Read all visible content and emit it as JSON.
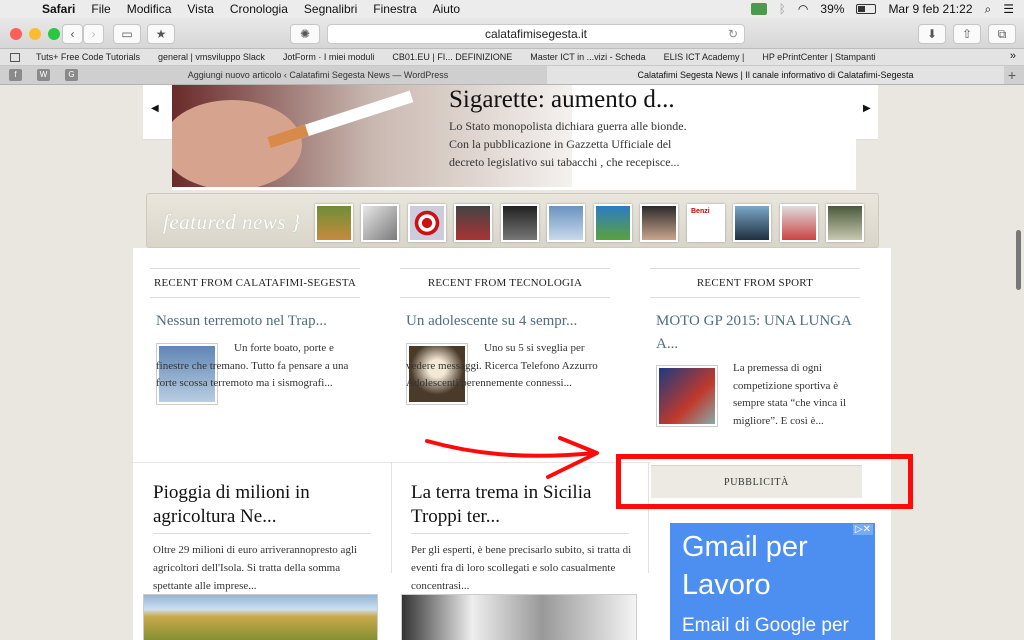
{
  "menubar": {
    "app": "Safari",
    "items": [
      "File",
      "Modifica",
      "Vista",
      "Cronologia",
      "Segnalibri",
      "Finestra",
      "Aiuto"
    ],
    "battery": "39%",
    "datetime": "Mar 9 feb  21:22"
  },
  "toolbar": {
    "url": "calatafimisegesta.it"
  },
  "bookmarks": [
    "Tuts+ Free Code Tutorials",
    "general | vmsviluppo Slack",
    "JotForm · I miei moduli",
    "CB01.EU | FI... DEFINIZIONE",
    "Master ICT in ...vizi - Scheda",
    "ELIS ICT Academy |",
    "HP ePrintCenter | Stampanti"
  ],
  "pinned_tabs": [
    "f",
    "W",
    "G"
  ],
  "tabs": [
    {
      "label": "Aggiungi nuovo articolo ‹ Calatafimi Segesta News — WordPress",
      "active": false
    },
    {
      "label": "Calatafimi Segesta News | Il canale informativo di Calatafimi-Segesta",
      "active": true
    }
  ],
  "slider": {
    "title": "Sigarette: aumento d...",
    "excerpt": "Lo Stato monopolista dichiara guerra alle bionde. Con la pubblicazione in Gazzetta Ufficiale del decreto legislativo sui tabacchi , che recepisce..."
  },
  "featured": {
    "label": "featured news }",
    "thumb_text": "Benzi"
  },
  "columns": [
    {
      "header": "RECENT FROM CALATAFIMI-SEGESTA",
      "title": "Nessun terremoto nel Trap...",
      "text": "Un forte boato, porte e finestre che tremano. Tutto fa pensare a una forte scossa terremoto ma i sismografi..."
    },
    {
      "header": "RECENT FROM TECNOLOGIA",
      "title": "Un adolescente su 4 sempr...",
      "text": "Uno su 5 si sveglia per vedere messaggi. Ricerca Telefono Azzurro Adolescenti perennemente connessi..."
    },
    {
      "header": "RECENT FROM SPORT",
      "title": "MOTO GP 2015: UNA LUNGA A...",
      "text": "La premessa di ogni competizione sportiva è sempre stata “che vinca il migliore”. E così è..."
    }
  ],
  "articles": [
    {
      "title": "Pioggia di milioni in agricoltura Ne...",
      "text": "Oltre 29 milioni di euro arriverannopresto agli agricoltori dell'Isola. Si tratta della somma spettante alle imprese..."
    },
    {
      "title": "La terra trema in Sicilia Troppi ter...",
      "text": "Per gli esperti, è bene precisarlo subito, si tratta di eventi fra di loro scollegati e solo casualmente concentrasi..."
    }
  ],
  "sidebar": {
    "ad_heading": "PUBBLICITÀ",
    "ad_line1": "Gmail per",
    "ad_line2": "Lavoro",
    "ad_line3": "Email di Google per",
    "ad_close": "▷✕"
  },
  "colors": {
    "highlight": "#ff0a0a",
    "link": "#4d6f7e",
    "ad_bg": "#4d8ff0"
  }
}
